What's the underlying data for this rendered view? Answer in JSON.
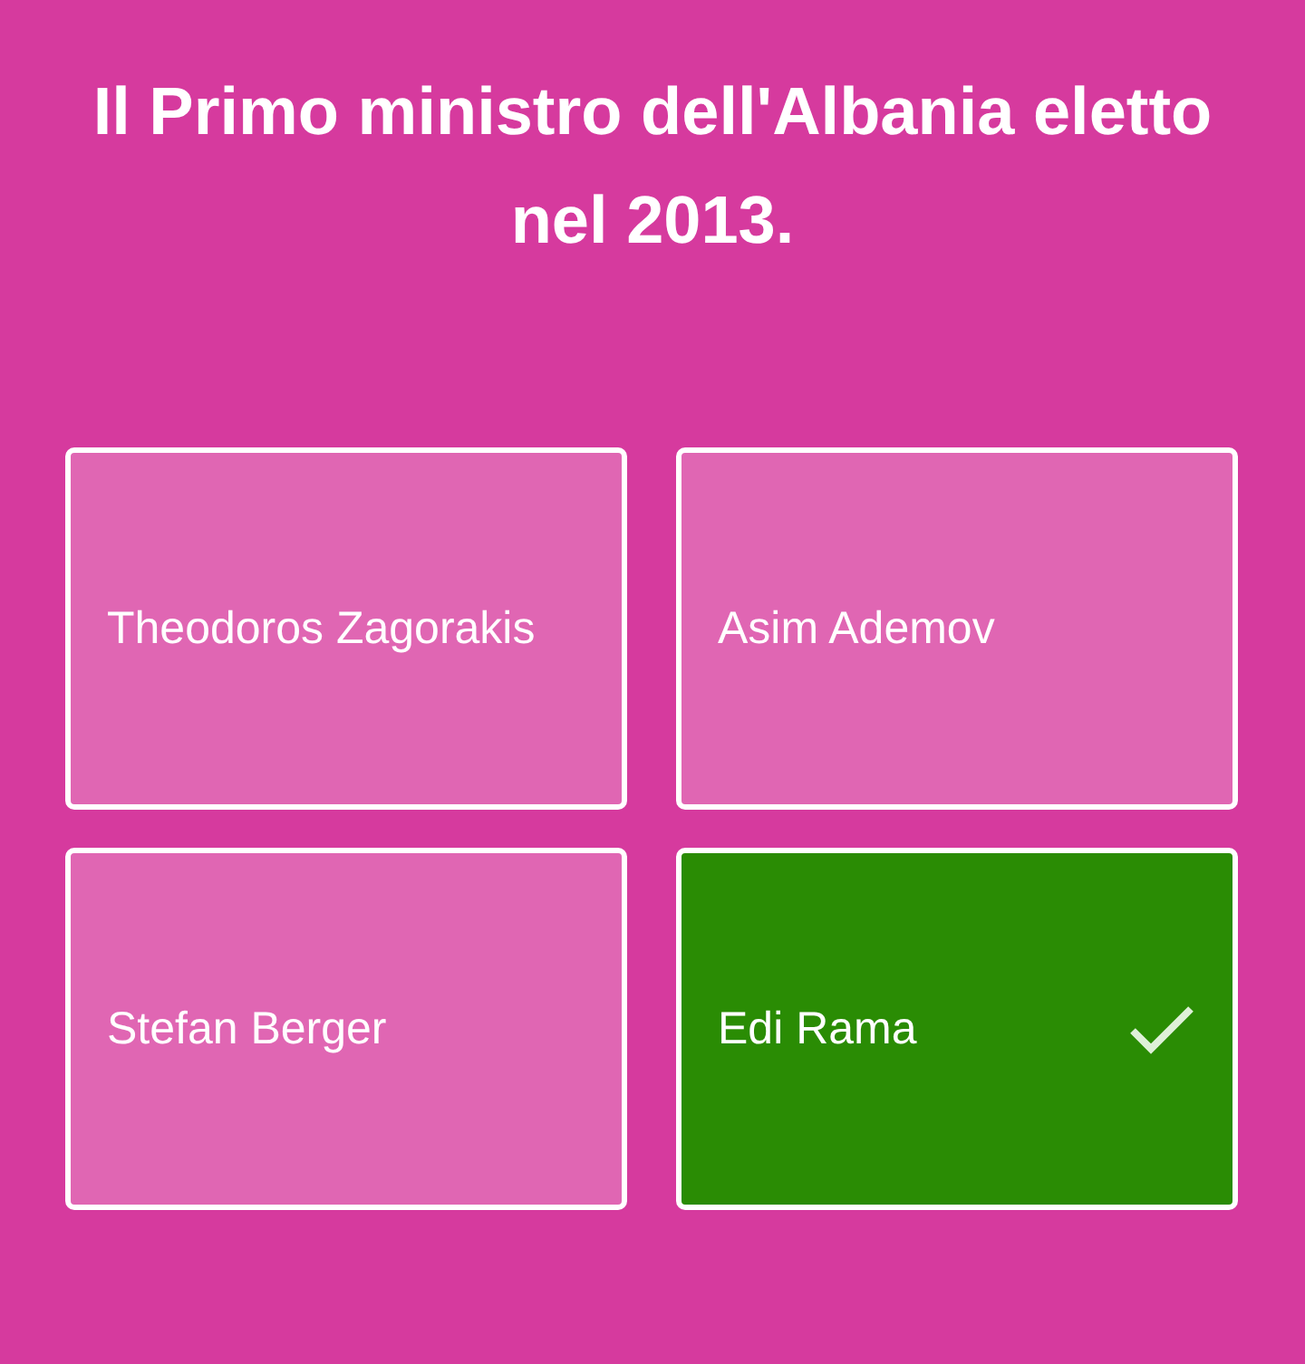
{
  "question": "Il Primo ministro dell'Albania eletto nel 2013.",
  "answers": [
    {
      "label": "Theodoros Zagorakis",
      "correct": false
    },
    {
      "label": "Asim Ademov",
      "correct": false
    },
    {
      "label": "Stefan Berger",
      "correct": false
    },
    {
      "label": "Edi Rama",
      "correct": true
    }
  ]
}
